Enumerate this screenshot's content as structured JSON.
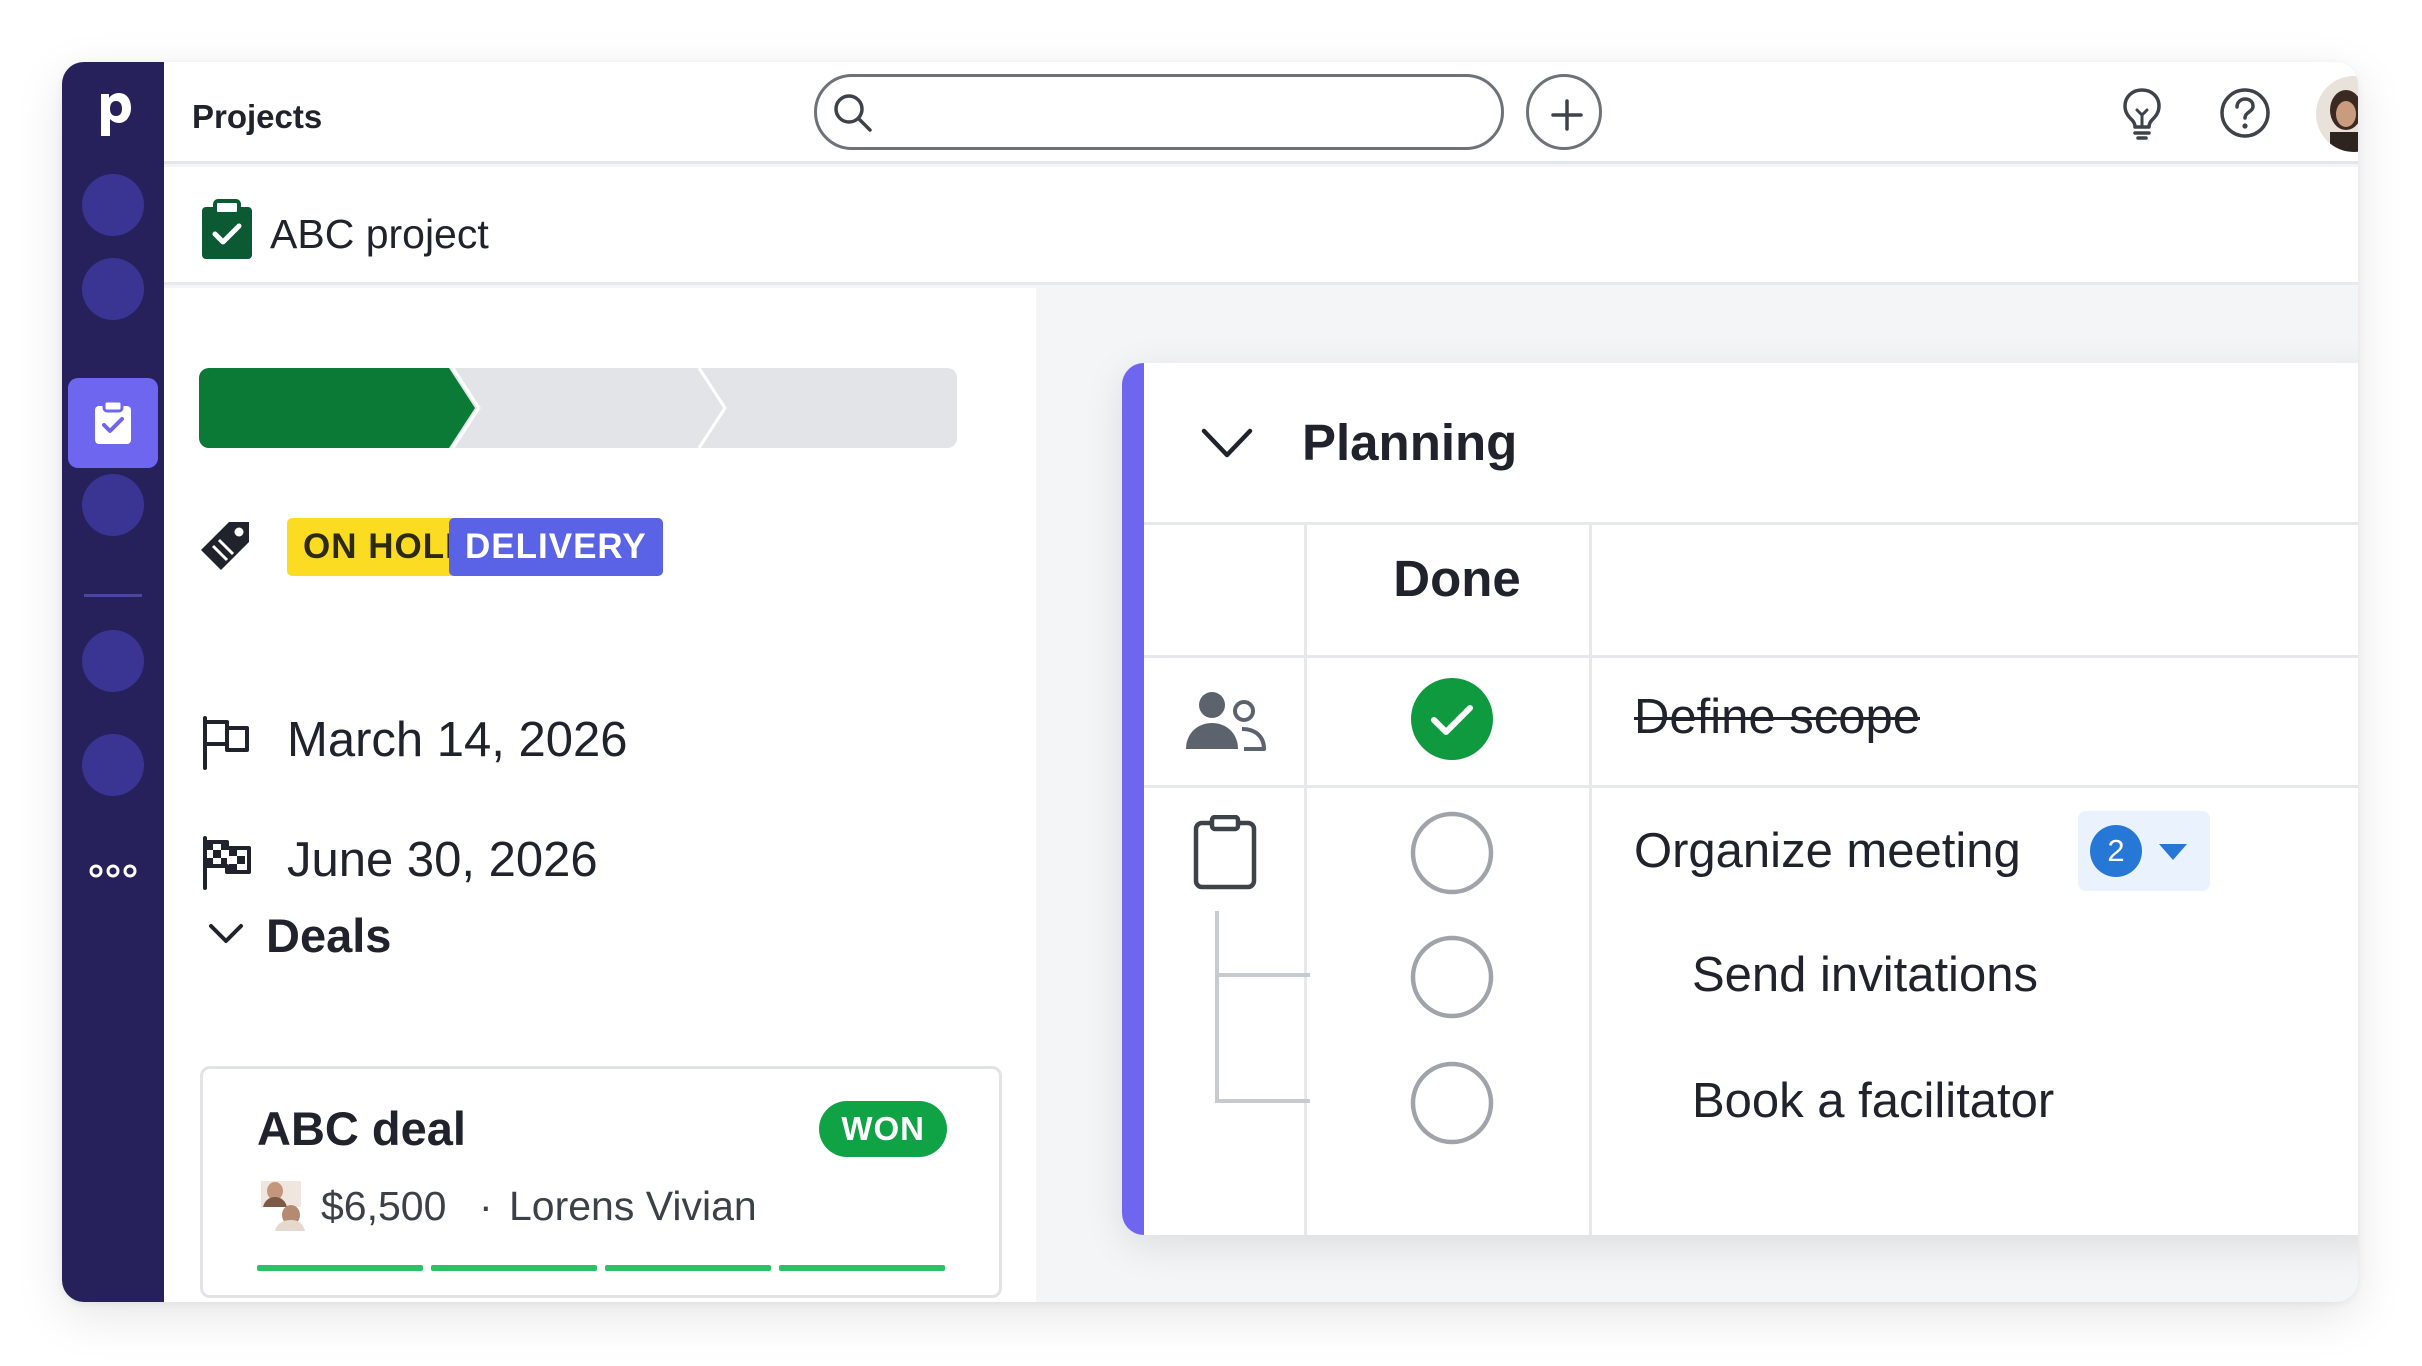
{
  "app": {
    "header_title": "Projects",
    "search": {
      "placeholder": ""
    },
    "add_label": "+"
  },
  "sidebar": {
    "logo_letter": "p",
    "items": [
      {
        "icon": "circle",
        "active": false
      },
      {
        "icon": "circle",
        "active": false
      },
      {
        "icon": "clipboard-check-icon",
        "active": true
      },
      {
        "icon": "circle",
        "active": false
      },
      {
        "icon": "circle",
        "active": false
      },
      {
        "icon": "circle",
        "active": false
      }
    ],
    "more_icon": "ellipsis-icon"
  },
  "project": {
    "title": "ABC project",
    "stage_progress": {
      "completed_stages": 1,
      "total_stages": 3
    },
    "labels": [
      "ON HOLD",
      "DELIVERY"
    ],
    "start_date": "March 14, 2026",
    "end_date": "June 30, 2026",
    "deals_title": "Deals",
    "deal": {
      "name": "ABC deal",
      "status": "WON",
      "amount": "$6,500",
      "separator": "·",
      "owner": "Lorens Vivian",
      "pipeline_segments_completed": 4
    }
  },
  "planning": {
    "title": "Planning",
    "column_done": "Done",
    "tasks": [
      {
        "title": "Define scope",
        "done": true,
        "icon": "people-icon"
      },
      {
        "title": "Organize meeting",
        "done": false,
        "icon": "clipboard-icon",
        "subtask_count": "2"
      },
      {
        "title": "Send invitations",
        "done": false,
        "subtask": true
      },
      {
        "title": "Book a facilitator",
        "done": false,
        "subtask": true
      }
    ]
  },
  "colors": {
    "sidebar": "#26215a",
    "accent": "#6e66ef",
    "stage_green": "#0b7a36",
    "on_hold": "#fbdc23",
    "delivery": "#5a63e6",
    "won": "#10a345",
    "check_green": "#0f9a40"
  }
}
